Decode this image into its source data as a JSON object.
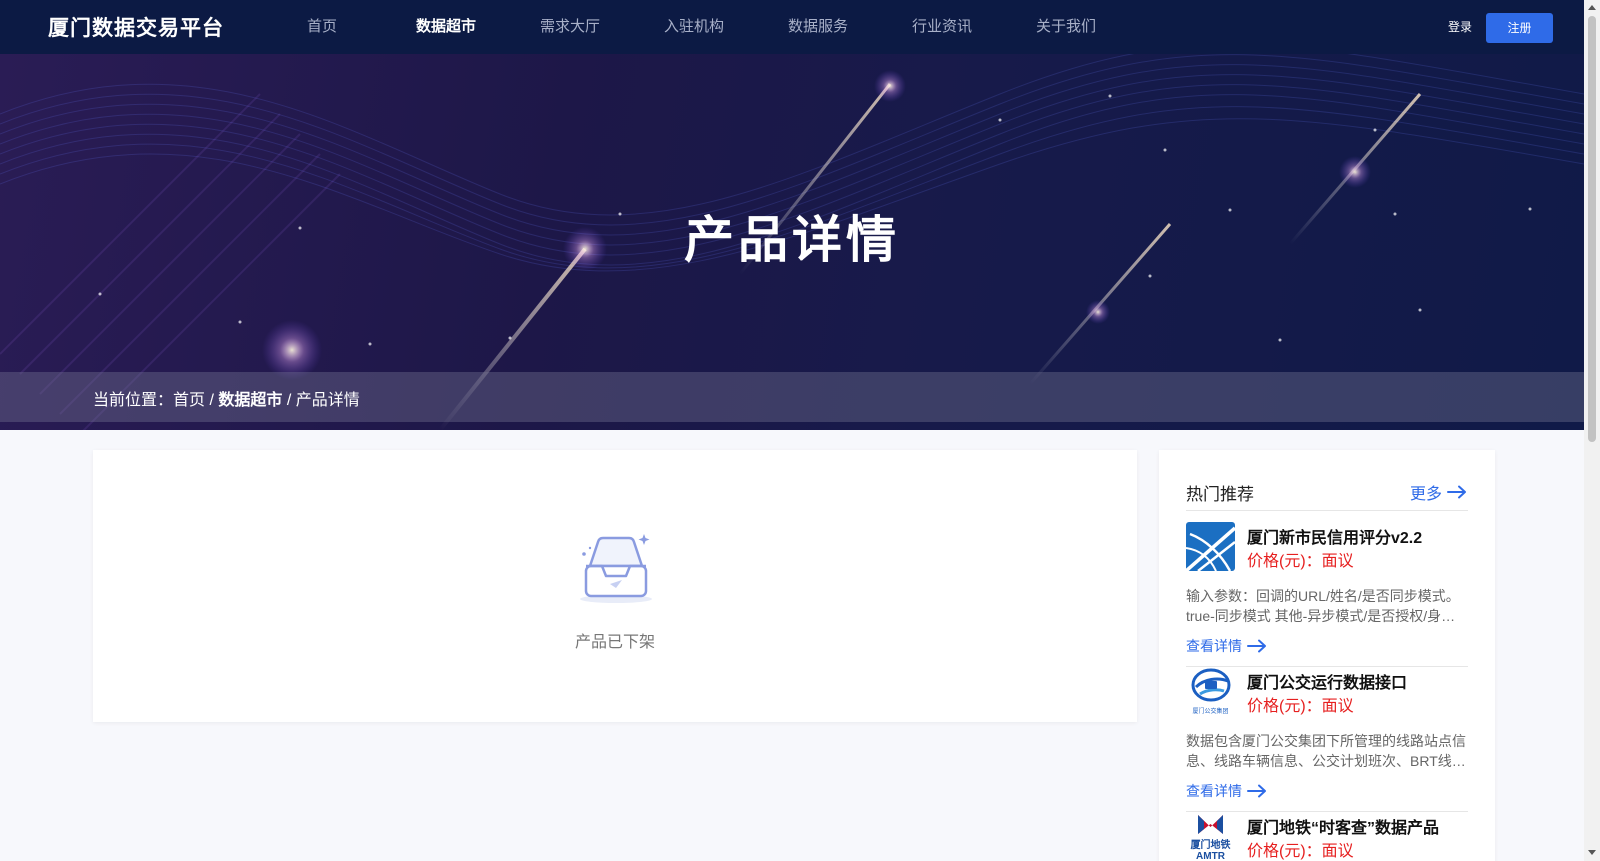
{
  "header": {
    "logo": "厦门数据交易平台",
    "nav": [
      "首页",
      "数据超市",
      "需求大厅",
      "入驻机构",
      "数据服务",
      "行业资讯",
      "关于我们"
    ],
    "active_nav": "数据超市",
    "login": "登录",
    "register": "注册"
  },
  "banner": {
    "title": "产品详情",
    "breadcrumb": {
      "prefix": "当前位置：",
      "home": "首页",
      "sep1": " / ",
      "section": "数据超市",
      "sep2": " / ",
      "current": "产品详情"
    }
  },
  "main": {
    "empty_text": "产品已下架"
  },
  "sidebar": {
    "title": "热门推荐",
    "more": "更多",
    "items": [
      {
        "name": "厦门新市民信用评分v2.2",
        "price": "价格(元)：面议",
        "desc": "输入参数：回调的URL/姓名/是否同步模式。true-同步模式 其他-异步模式/是否授权/身…",
        "link": "查看详情",
        "logo": "cross-road-logo"
      },
      {
        "name": "厦门公交运行数据接口",
        "price": "价格(元)：面议",
        "desc": "数据包含厦门公交集团下所管理的线路站点信息、线路车辆信息、公交计划班次、BRT线…",
        "link": "查看详情",
        "logo": "bus-group-logo",
        "logo_caption": "厦门公交集团"
      },
      {
        "name": "厦门地铁“时客查”数据产品",
        "price": "价格(元)：面议",
        "desc": "",
        "link": "",
        "logo": "metro-logo",
        "logo_caption": "厦门地铁",
        "logo_caption2": "AMTR"
      }
    ]
  },
  "colors": {
    "header_bg": "#0c1a44",
    "accent": "#2f6be8",
    "price": "#e62020"
  }
}
